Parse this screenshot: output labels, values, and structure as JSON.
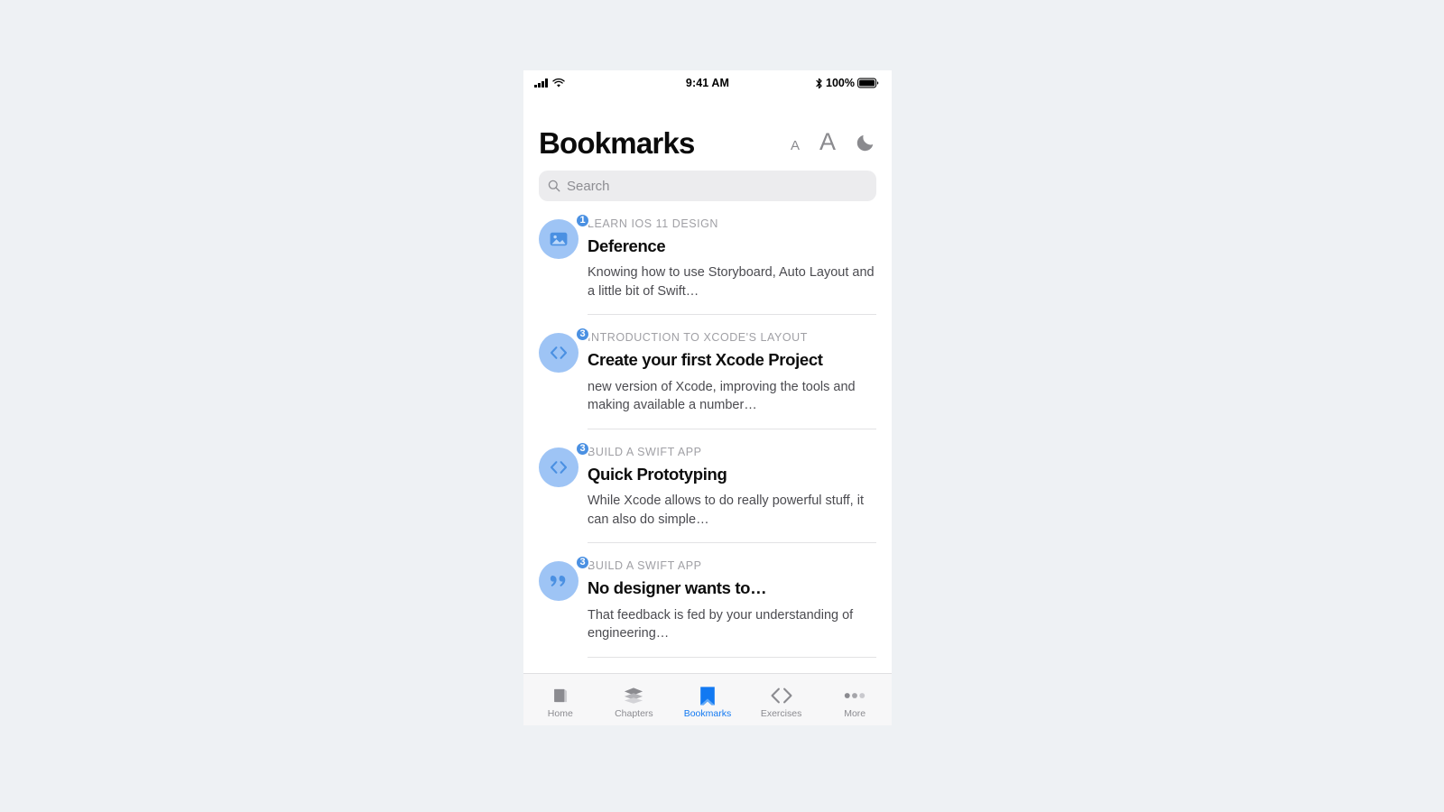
{
  "theme": {
    "page_bg": "#eef1f4",
    "phone_bg": "#ffffff",
    "accent": "#1279f2",
    "avatar_bg": "#9ec4f5",
    "badge_bg": "#4a90e2",
    "muted_text": "#a0a0a5",
    "tabbar_bg": "#f7f7f8"
  },
  "status_bar": {
    "signal_icon": "cellular-bars-icon",
    "wifi_icon": "wifi-icon",
    "time": "9:41 AM",
    "bluetooth_icon": "bluetooth-icon",
    "battery_percent": "100%",
    "battery_icon": "battery-full-icon"
  },
  "header": {
    "title": "Bookmarks",
    "actions": [
      {
        "name": "text-size-small-button",
        "glyph": "A",
        "icon": "letter-a-small-icon"
      },
      {
        "name": "text-size-large-button",
        "glyph": "A",
        "icon": "letter-a-large-icon"
      },
      {
        "name": "dark-mode-toggle",
        "glyph": "",
        "icon": "moon-icon"
      }
    ]
  },
  "search": {
    "placeholder": "Search",
    "value": "",
    "icon": "search-icon"
  },
  "bookmarks": [
    {
      "icon": "photo-icon",
      "badge": "1",
      "kicker": "LEARN IOS 11 DESIGN",
      "title": "Deference",
      "description": "Knowing how to use Storyboard, Auto Layout and a little bit of Swift…"
    },
    {
      "icon": "code-brackets-icon",
      "badge": "3",
      "kicker": "INTRODUCTION TO XCODE'S LAYOUT",
      "title": "Create your first Xcode Project",
      "description": "new version of Xcode, improving the tools and making available a number…"
    },
    {
      "icon": "code-brackets-icon",
      "badge": "3",
      "kicker": "BUILD A SWIFT APP",
      "title": "Quick Prototyping",
      "description": "While Xcode allows to do really powerful stuff, it can also do simple…"
    },
    {
      "icon": "quote-icon",
      "badge": "3",
      "kicker": "BUILD A SWIFT APP",
      "title": "No designer wants to…",
      "description": "That feedback is fed by your understanding of engineering…"
    }
  ],
  "tabbar": {
    "active_index": 2,
    "tabs": [
      {
        "label": "Home",
        "icon": "book-icon"
      },
      {
        "label": "Chapters",
        "icon": "layers-icon"
      },
      {
        "label": "Bookmarks",
        "icon": "bookmark-icon"
      },
      {
        "label": "Exercises",
        "icon": "code-brackets-icon"
      },
      {
        "label": "More",
        "icon": "ellipsis-icon"
      }
    ]
  }
}
